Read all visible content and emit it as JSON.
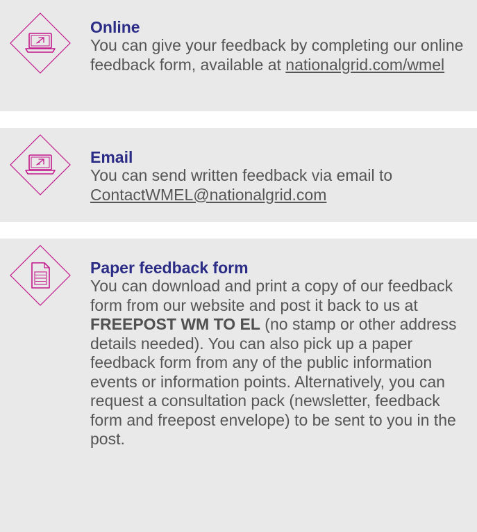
{
  "colors": {
    "card_background": "#e9e9e9",
    "title": "#2b2c86",
    "body_text": "#555555",
    "icon_stroke": "#c2188b"
  },
  "cards": {
    "online": {
      "icon": "laptop-icon",
      "title": "Online",
      "text": "You can give your feedback by completing our online feedback form, available at ",
      "link": "nationalgrid.com/wmel"
    },
    "email": {
      "icon": "laptop-icon",
      "title": "Email",
      "text": "You can send written feedback via email to ",
      "link": "ContactWMEL@nationalgrid.com"
    },
    "paper": {
      "icon": "document-icon",
      "title": "Paper feedback form",
      "text_before": "You can download and print a copy of our feedback form from our website and post it back to us at ",
      "bold": "FREEPOST WM TO EL",
      "text_after": " (no stamp or other address details needed). You can also pick up a paper feedback form from any of the public information events or information points. Alternatively, you can request a consultation pack (newsletter, feedback form and freepost envelope) to be sent to you in the post."
    }
  }
}
